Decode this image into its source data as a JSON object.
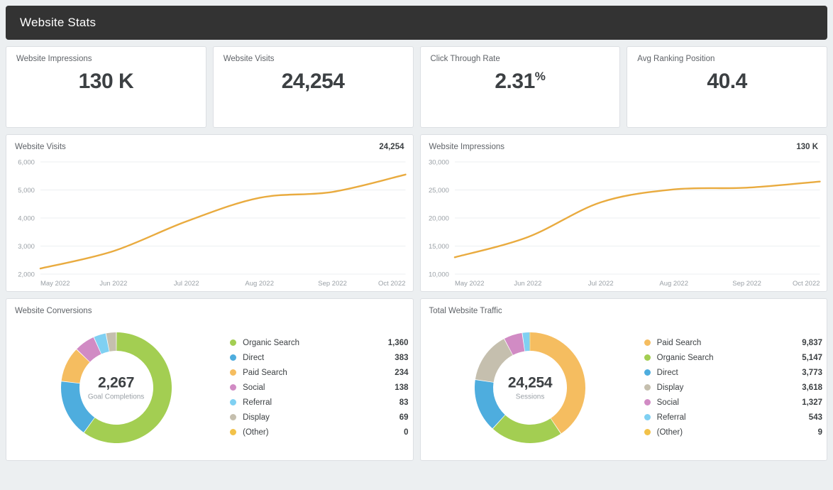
{
  "header": {
    "title": "Website Stats"
  },
  "accent": {
    "line": "#e9ab3f",
    "header_bg": "#333333",
    "page_bg": "#eceff1",
    "panel_bg": "#ffffff",
    "text": "#3c4043",
    "muted": "#9aa0a6"
  },
  "kpis": [
    {
      "label": "Website Impressions",
      "value": "130 K",
      "suffix": ""
    },
    {
      "label": "Website Visits",
      "value": "24,254",
      "suffix": ""
    },
    {
      "label": "Click Through Rate",
      "value": "2.31",
      "suffix": "%"
    },
    {
      "label": "Avg Ranking Position",
      "value": "40.4",
      "suffix": ""
    }
  ],
  "line_panels": [
    {
      "title": "Website Visits",
      "value": "24,254"
    },
    {
      "title": "Website Impressions",
      "value": "130 K"
    }
  ],
  "donut_panels": [
    {
      "title": "Website Conversions",
      "center_value": "2,267",
      "center_label": "Goal Completions"
    },
    {
      "title": "Total Website Traffic",
      "center_value": "24,254",
      "center_label": "Sessions"
    }
  ],
  "chart_data": [
    {
      "type": "line",
      "title": "Website Visits",
      "xlabel": "",
      "ylabel": "",
      "ylim": [
        2000,
        6000
      ],
      "yticks": [
        "2,000",
        "3,000",
        "4,000",
        "5,000",
        "6,000"
      ],
      "ytick_values": [
        2000,
        3000,
        4000,
        5000,
        6000
      ],
      "xticks": [
        "May 2022",
        "Jun 2022",
        "Jul 2022",
        "Aug 2022",
        "Sep 2022",
        "Oct 2022"
      ],
      "grid": true,
      "legend": "none",
      "series": [
        {
          "name": "Website Visits",
          "color": "#e9ab3f",
          "x": [
            "May 2022",
            "Jun 2022",
            "Jul 2022",
            "Aug 2022",
            "Sep 2022",
            "Oct 2022"
          ],
          "values": [
            2200,
            2820,
            3880,
            4720,
            4930,
            5550
          ]
        }
      ]
    },
    {
      "type": "line",
      "title": "Website Impressions",
      "xlabel": "",
      "ylabel": "",
      "ylim": [
        10000,
        30000
      ],
      "yticks": [
        "10,000",
        "15,000",
        "20,000",
        "25,000",
        "30,000"
      ],
      "ytick_values": [
        10000,
        15000,
        20000,
        25000,
        30000
      ],
      "xticks": [
        "May 2022",
        "Jun 2022",
        "Jul 2022",
        "Aug 2022",
        "Sep 2022",
        "Oct 2022"
      ],
      "grid": true,
      "legend": "none",
      "series": [
        {
          "name": "Website Impressions",
          "color": "#e9ab3f",
          "x": [
            "May 2022",
            "Jun 2022",
            "Jul 2022",
            "Aug 2022",
            "Sep 2022",
            "Oct 2022"
          ],
          "values": [
            13000,
            16600,
            22800,
            25100,
            25400,
            26500
          ]
        }
      ]
    },
    {
      "type": "pie",
      "title": "Website Conversions",
      "center_value": "2,267",
      "center_label": "Goal Completions",
      "legend": "right",
      "labels": [
        "Organic Search",
        "Direct",
        "Paid Search",
        "Social",
        "Referral",
        "Display",
        "(Other)"
      ],
      "values": [
        1360,
        383,
        234,
        138,
        83,
        69,
        0
      ],
      "display_values": [
        "1,360",
        "383",
        "234",
        "138",
        "83",
        "69",
        "0"
      ],
      "colors": [
        "#a3ce52",
        "#4eadde",
        "#f5bd60",
        "#d18bc4",
        "#7fd0f2",
        "#c5bfae",
        "#f2c249"
      ]
    },
    {
      "type": "pie",
      "title": "Total Website Traffic",
      "center_value": "24,254",
      "center_label": "Sessions",
      "legend": "right",
      "labels": [
        "Paid Search",
        "Organic Search",
        "Direct",
        "Display",
        "Social",
        "Referral",
        "(Other)"
      ],
      "values": [
        9837,
        5147,
        3773,
        3618,
        1327,
        543,
        9
      ],
      "display_values": [
        "9,837",
        "5,147",
        "3,773",
        "3,618",
        "1,327",
        "543",
        "9"
      ],
      "colors": [
        "#f5bd60",
        "#a3ce52",
        "#4eadde",
        "#c5bfae",
        "#d18bc4",
        "#7fd0f2",
        "#f2c249"
      ]
    }
  ]
}
